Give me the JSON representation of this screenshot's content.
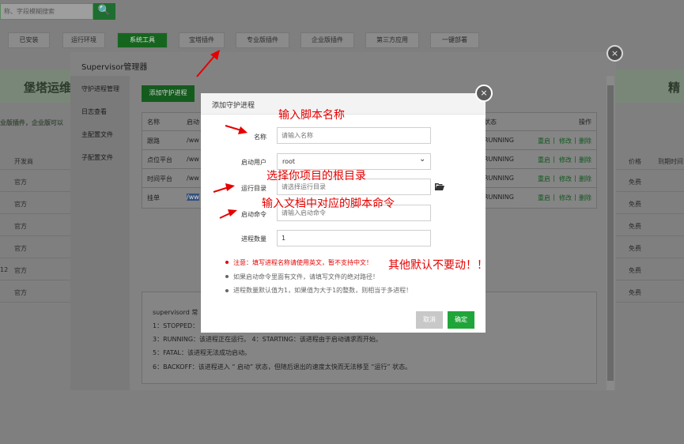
{
  "background": {
    "search_placeholder": "称、字段模糊搜索",
    "search_button": "🔍",
    "tabs": [
      "已安装",
      "运行环境",
      "系统工具",
      "宝塔插件",
      "专业版插件",
      "企业版插件",
      "第三方应用",
      "一键部署"
    ],
    "banner_title": "堡塔运维",
    "banner_right": "精",
    "notice": "业版插件，企业版可以",
    "columns": {
      "developer": "开发商",
      "price": "价格",
      "expire": "到期时间"
    },
    "rows": [
      {
        "dev": "官方",
        "price": "免费"
      },
      {
        "dev": "官方",
        "price": "免费"
      },
      {
        "dev": "官方",
        "price": "免费"
      },
      {
        "dev": "官方",
        "price": "免费"
      },
      {
        "dev": "官方",
        "price": "免费"
      },
      {
        "dev": "官方",
        "price": "免费"
      }
    ],
    "row_prefix_5": "12"
  },
  "supervisor": {
    "title": "Supervisor管理器",
    "close_label": "×",
    "sidebar": [
      "守护进程管理",
      "日志查看",
      "主配置文件",
      "子配置文件"
    ],
    "add_button": "添加守护进程",
    "table": {
      "headers": {
        "name": "名称",
        "start": "启动",
        "status": "状态",
        "actions": "操作"
      },
      "rows": [
        {
          "name": "跟路",
          "start": "/ww",
          "status": "RUNNING"
        },
        {
          "name": "点位平台",
          "start": "/ww",
          "status": "RUNNING"
        },
        {
          "name": "时间平台",
          "start": "/ww",
          "status": "RUNNING"
        },
        {
          "name": "挂单",
          "start": "/ww",
          "status": "RUNNING"
        }
      ],
      "actions": {
        "restart": "重启",
        "edit": "修改",
        "delete": "删除",
        "sep": "|"
      }
    },
    "info": {
      "title": "supervisord 常",
      "lines": [
        "1：STOPPED：",
        "3：RUNNING：该进程正在运行。  4：STARTING：该进程由于启动请求而开始。",
        "5：FATAL：该进程无法成功启动。",
        "6：BACKOFF：该进程进入 “ 启动” 状态，但随后退出的速度太快而无法移至 “运行” 状态。"
      ]
    }
  },
  "dialog": {
    "title": "添加守护进程",
    "close_label": "×",
    "fields": {
      "name": {
        "label": "名称",
        "placeholder": "请输入名称"
      },
      "user": {
        "label": "启动用户",
        "value": "root"
      },
      "dir": {
        "label": "运行目录",
        "placeholder": "请选择运行目录"
      },
      "command": {
        "label": "启动命令",
        "placeholder": "请输入启动命令"
      },
      "count": {
        "label": "进程数量",
        "value": "1"
      }
    },
    "notes": [
      "注意：填写进程名称请使用英文，暂不支持中文！",
      "如果启动命令里面有文件，请填写文件的绝对路径！",
      "进程数量默认值为1，如果值为大于1的整数，则相当于多进程！"
    ],
    "cancel": "取消",
    "ok": "确定"
  },
  "annotations": {
    "script_name": "输入脚本名称",
    "root_dir": "选择你项目的根目录",
    "command": "输入文档中对应的脚本命令",
    "others": "其他默认不要动！！"
  },
  "colors": {
    "accent": "#20a53a",
    "annotation": "#e60000",
    "note_red": "#e60000"
  }
}
